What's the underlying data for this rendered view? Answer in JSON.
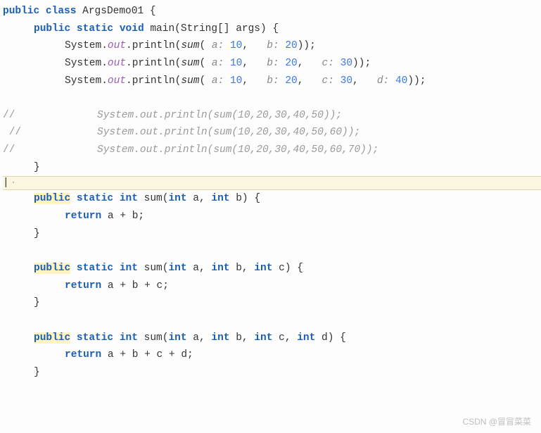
{
  "code": {
    "class_decl": {
      "public": "public",
      "class": "class",
      "name": "ArgsDemo01",
      "brace": "{"
    },
    "main_decl": {
      "public": "public",
      "static": "static",
      "void": "void",
      "name": "main",
      "paramtype": "String[]",
      "paramname": "args",
      "brace": "{"
    },
    "call1": {
      "sys": "System",
      "out": "out",
      "println": "println",
      "sum": "sum",
      "a": "a:",
      "av": "10",
      "b": "b:",
      "bv": "20"
    },
    "call2": {
      "sys": "System",
      "out": "out",
      "println": "println",
      "sum": "sum",
      "a": "a:",
      "av": "10",
      "b": "b:",
      "bv": "20",
      "c": "c:",
      "cv": "30"
    },
    "call3": {
      "sys": "System",
      "out": "out",
      "println": "println",
      "sum": "sum",
      "a": "a:",
      "av": "10",
      "b": "b:",
      "bv": "20",
      "c": "c:",
      "cv": "30",
      "d": "d:",
      "dv": "40"
    },
    "comment1": "System.out.println(sum(10,20,30,40,50));",
    "comment2": "System.out.println(sum(10,20,30,40,50,60));",
    "comment3": "System.out.println(sum(10,20,30,40,50,60,70));",
    "slashes": "//",
    "close_brace": "}",
    "caret": "|",
    "dash": "·",
    "m1": {
      "public": "public",
      "static": "static",
      "int": "int",
      "name": "sum",
      "p1t": "int",
      "p1n": "a",
      "p2t": "int",
      "p2n": "b",
      "brace": "{",
      "return": "return",
      "expr": "a + b;"
    },
    "m2": {
      "public": "public",
      "static": "static",
      "int": "int",
      "name": "sum",
      "p1t": "int",
      "p1n": "a",
      "p2t": "int",
      "p2n": "b",
      "p3t": "int",
      "p3n": "c",
      "brace": "{",
      "return": "return",
      "expr": "a + b + c;"
    },
    "m3": {
      "public": "public",
      "static": "static",
      "int": "int",
      "name": "sum",
      "p1t": "int",
      "p1n": "a",
      "p2t": "int",
      "p2n": "b",
      "p3t": "int",
      "p3n": "c",
      "p4t": "int",
      "p4n": "d",
      "brace": "{",
      "return": "return",
      "expr": "a + b + c + d;"
    }
  },
  "watermark": "CSDN @冒冒菜菜"
}
